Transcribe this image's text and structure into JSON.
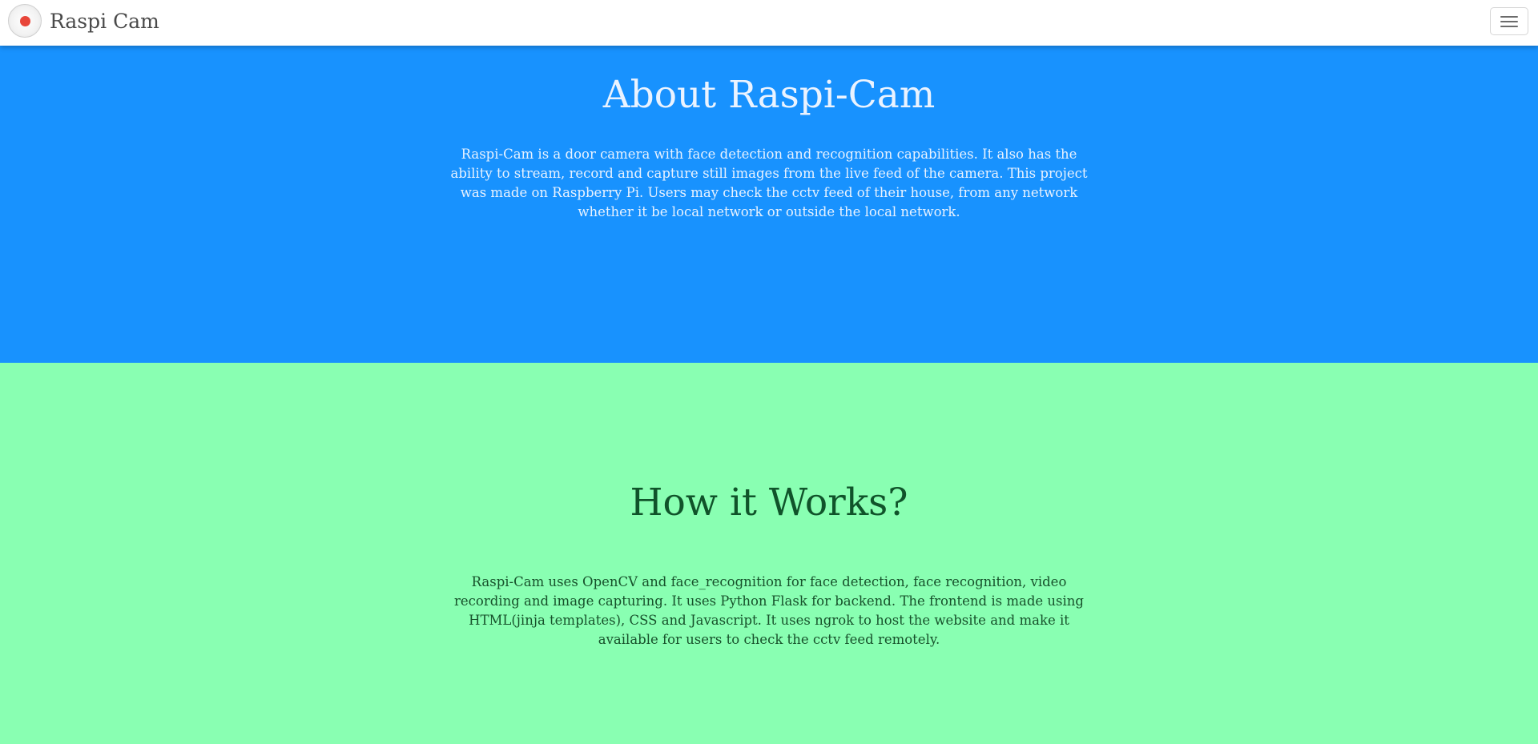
{
  "navbar": {
    "brand": "Raspi Cam",
    "logo_icon": "record-icon",
    "menu_icon": "hamburger-menu-icon",
    "accent_color": "#e8463a"
  },
  "about": {
    "title": "About Raspi-Cam",
    "text": "Raspi-Cam is a door camera with face detection and recognition capabilities. It also has the ability to stream, record and capture still images from the live feed of the camera. This project was made on Raspberry Pi. Users may check the cctv feed of their house, from any network whether it be local network or outside the local network.",
    "background": "#1892fe"
  },
  "how": {
    "title": "How it Works?",
    "text": "Raspi-Cam uses OpenCV and face_recognition for face detection, face recognition, video recording and image capturing. It uses Python Flask for backend. The frontend is made using HTML(jinja templates), CSS and Javascript. It uses ngrok to host the website and make it available for users to check the cctv feed remotely.",
    "background": "#89ffb2"
  }
}
